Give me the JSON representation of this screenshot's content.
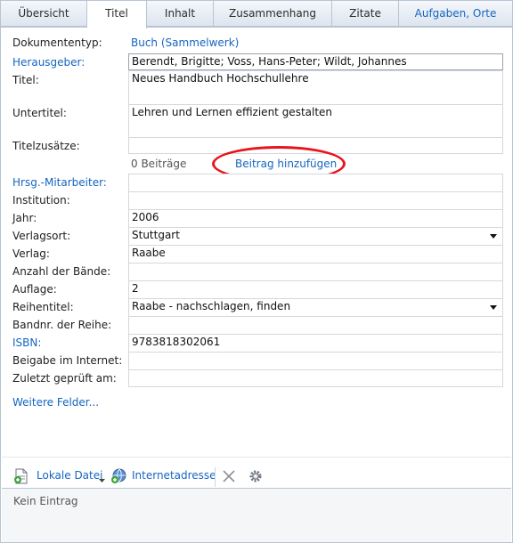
{
  "tabs": [
    {
      "label": "Übersicht",
      "active": false
    },
    {
      "label": "Titel",
      "active": true
    },
    {
      "label": "Inhalt",
      "active": false
    },
    {
      "label": "Zusammenhang",
      "active": false
    },
    {
      "label": "Zitate",
      "active": false
    },
    {
      "label": "Aufgaben, Orte",
      "active": false
    }
  ],
  "form": {
    "doc_type_label": "Dokumententyp:",
    "doc_type_value": "Buch (Sammelwerk)",
    "fields": [
      {
        "label": "Herausgeber:",
        "value": "Berendt, Brigitte; Voss, Hans-Peter; Wildt, Johannes"
      },
      {
        "label": "Titel:",
        "value": "Neues Handbuch Hochschullehre"
      },
      {
        "label": "Untertitel:",
        "value": "Lehren und Lernen effizient gestalten"
      },
      {
        "label": "Titelzusätze:",
        "value": ""
      },
      {
        "label": "Hrsg.-Mitarbeiter:",
        "value": ""
      },
      {
        "label": "Institution:",
        "value": ""
      },
      {
        "label": "Jahr:",
        "value": "2006"
      },
      {
        "label": "Verlagsort:",
        "value": "Stuttgart"
      },
      {
        "label": "Verlag:",
        "value": "Raabe"
      },
      {
        "label": "Anzahl der Bände:",
        "value": ""
      },
      {
        "label": "Auflage:",
        "value": "2"
      },
      {
        "label": "Reihentitel:",
        "value": "Raabe - nachschlagen, finden"
      },
      {
        "label": "Bandnr. der Reihe:",
        "value": ""
      },
      {
        "label": "ISBN:",
        "value": "9783818302061"
      },
      {
        "label": "Beigabe im Internet:",
        "value": ""
      },
      {
        "label": "Zuletzt geprüft am:",
        "value": ""
      }
    ],
    "contributions_count": "0 Beiträge",
    "add_contribution": "Beitrag hinzufügen",
    "more_fields": "Weitere Felder..."
  },
  "toolbar": {
    "local_file": "Lokale Datei",
    "internet_address": "Internetadresse"
  },
  "status": {
    "text": "Kein Eintrag"
  },
  "colors": {
    "link": "#1565c0",
    "highlight_ring": "#e8141d",
    "border": "#b9c4d2"
  }
}
